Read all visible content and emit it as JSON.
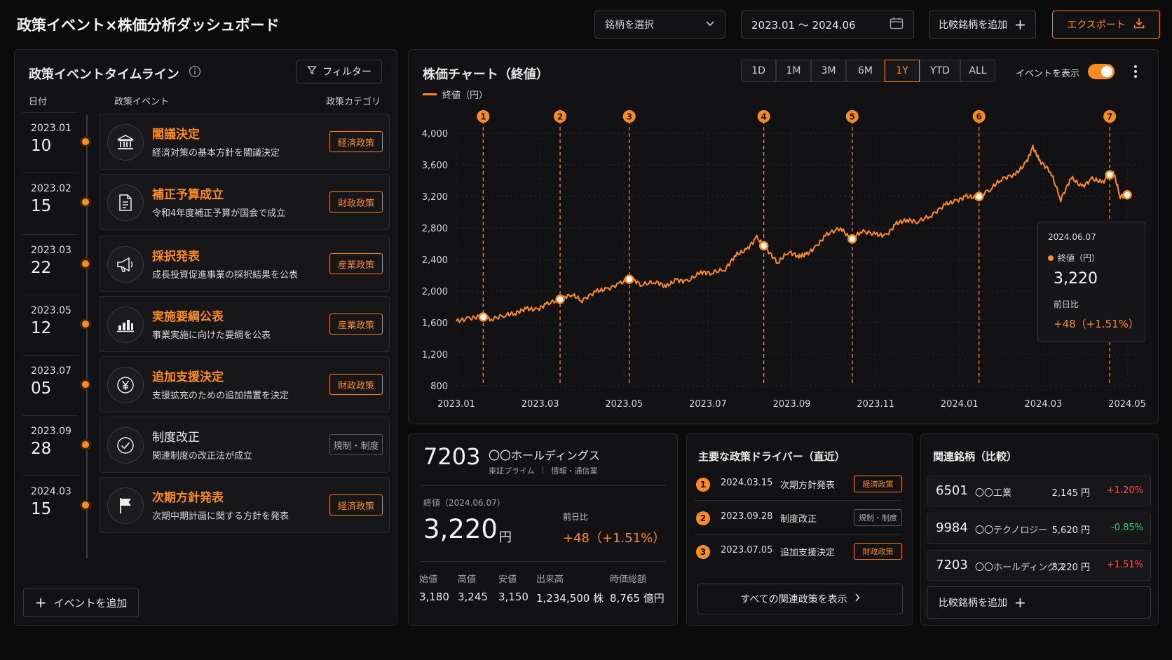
{
  "header": {
    "title": "政策イベント×株価分析ダッシュボード",
    "stock_select": "銘柄を選択",
    "date_range": "2023.01 〜 2024.06",
    "add_compare": "比較銘柄を追加",
    "export": "エクスポート"
  },
  "timeline": {
    "title": "政策イベントタイムライン",
    "filter": "フィルター",
    "col_date": "日付",
    "col_event": "政策イベント",
    "col_category": "政策カテゴリ",
    "add_event": "イベントを追加",
    "items": [
      {
        "ym": "2023.01",
        "d": "10",
        "title": "閣議決定",
        "desc": "経済対策の基本方針を閣議決定",
        "category": "経済政策",
        "icon": "building-icon",
        "highlight": true
      },
      {
        "ym": "2023.02",
        "d": "15",
        "title": "補正予算成立",
        "desc": "令和4年度補正予算が国会で成立",
        "category": "財政政策",
        "icon": "document-icon",
        "highlight": true
      },
      {
        "ym": "2023.03",
        "d": "22",
        "title": "採択発表",
        "desc": "成長投資促進事業の採択結果を公表",
        "category": "産業政策",
        "icon": "megaphone-icon",
        "highlight": true
      },
      {
        "ym": "2023.05",
        "d": "12",
        "title": "実施要綱公表",
        "desc": "事業実施に向けた要綱を公表",
        "category": "産業政策",
        "icon": "bar-chart-icon",
        "highlight": true
      },
      {
        "ym": "2023.07",
        "d": "05",
        "title": "追加支援決定",
        "desc": "支援拡充のための追加措置を決定",
        "category": "財政政策",
        "icon": "yen-icon",
        "highlight": true
      },
      {
        "ym": "2023.09",
        "d": "28",
        "title": "制度改正",
        "desc": "関連制度の改正法が成立",
        "category": "規制・制度",
        "icon": "check-circle-icon",
        "highlight": false
      },
      {
        "ym": "2024.03",
        "d": "15",
        "title": "次期方針発表",
        "desc": "次期中期計画に関する方針を発表",
        "category": "経済政策",
        "icon": "flag-icon",
        "highlight": true
      }
    ]
  },
  "chart": {
    "title": "株価チャート（終値）",
    "legend": "終値（円）",
    "ranges": [
      "1D",
      "1M",
      "3M",
      "6M",
      "1Y",
      "YTD",
      "ALL"
    ],
    "active_range": "1Y",
    "show_events_label": "イベントを表示",
    "tooltip": {
      "date": "2024.06.07",
      "label": "終値（円）",
      "value": "3,220",
      "change_label": "前日比",
      "change": "+48（+1.51%）"
    }
  },
  "chart_data": {
    "type": "line",
    "title": "株価チャート（終値）",
    "series": [
      {
        "name": "終値（円）",
        "color": "#ff8a1f"
      }
    ],
    "ylim": [
      800,
      4000
    ],
    "yticks": [
      800,
      1200,
      1600,
      2000,
      2400,
      2800,
      3200,
      3600,
      4000
    ],
    "xlim": [
      0,
      17.2
    ],
    "xticks": [
      {
        "t": 0,
        "label": "2023.01"
      },
      {
        "t": 2,
        "label": "2023.03"
      },
      {
        "t": 4,
        "label": "2023.05"
      },
      {
        "t": 6,
        "label": "2023.07"
      },
      {
        "t": 8,
        "label": "2023.09"
      },
      {
        "t": 10,
        "label": "2023.11"
      },
      {
        "t": 12,
        "label": "2024.01"
      },
      {
        "t": 14,
        "label": "2024.03"
      },
      {
        "t": 16,
        "label": "2024.05"
      }
    ],
    "points": [
      [
        0,
        1620
      ],
      [
        0.35,
        1650
      ],
      [
        0.7,
        1680
      ],
      [
        1.0,
        1640
      ],
      [
        1.4,
        1700
      ],
      [
        1.7,
        1720
      ],
      [
        2.0,
        1780
      ],
      [
        2.3,
        1760
      ],
      [
        2.6,
        1840
      ],
      [
        3.0,
        1900
      ],
      [
        3.3,
        1960
      ],
      [
        3.6,
        1880
      ],
      [
        4.0,
        2000
      ],
      [
        4.3,
        2020
      ],
      [
        4.7,
        2100
      ],
      [
        5.0,
        2160
      ],
      [
        5.3,
        2080
      ],
      [
        5.7,
        2120
      ],
      [
        6.0,
        2060
      ],
      [
        6.3,
        2140
      ],
      [
        6.6,
        2120
      ],
      [
        7.0,
        2240
      ],
      [
        7.3,
        2230
      ],
      [
        7.7,
        2280
      ],
      [
        8.0,
        2460
      ],
      [
        8.3,
        2520
      ],
      [
        8.6,
        2680
      ],
      [
        8.9,
        2520
      ],
      [
        9.2,
        2360
      ],
      [
        9.5,
        2500
      ],
      [
        9.8,
        2440
      ],
      [
        10.0,
        2460
      ],
      [
        10.3,
        2560
      ],
      [
        10.6,
        2720
      ],
      [
        11.0,
        2800
      ],
      [
        11.3,
        2650
      ],
      [
        11.6,
        2760
      ],
      [
        12.0,
        2720
      ],
      [
        12.3,
        2700
      ],
      [
        12.6,
        2860
      ],
      [
        12.9,
        2900
      ],
      [
        13.2,
        2880
      ],
      [
        13.6,
        2960
      ],
      [
        14.0,
        3100
      ],
      [
        14.3,
        3140
      ],
      [
        14.6,
        3200
      ],
      [
        14.9,
        3180
      ],
      [
        15.3,
        3300
      ],
      [
        15.6,
        3420
      ],
      [
        16.0,
        3480
      ],
      [
        16.3,
        3620
      ],
      [
        16.5,
        3820
      ],
      [
        16.7,
        3650
      ],
      [
        17.0,
        3520
      ],
      [
        17.3,
        3160
      ],
      [
        17.6,
        3440
      ],
      [
        17.9,
        3320
      ],
      [
        18.2,
        3420
      ],
      [
        18.5,
        3380
      ],
      [
        18.8,
        3520
      ],
      [
        19.0,
        3200
      ],
      [
        19.2,
        3220
      ]
    ],
    "events": [
      {
        "n": "1",
        "t": 0.35,
        "v": 1620
      },
      {
        "n": "2",
        "t": 1.35,
        "v": 1780
      },
      {
        "n": "3",
        "t": 2.25,
        "v": 2000
      },
      {
        "n": "4",
        "t": 4.0,
        "v": 2460
      },
      {
        "n": "5",
        "t": 5.15,
        "v": 2460
      },
      {
        "n": "6",
        "t": 6.8,
        "v": 3100
      },
      {
        "n": "7",
        "t": 8.5,
        "v": 3160
      }
    ]
  },
  "quote": {
    "code": "7203",
    "name": "〇〇ホールディングス",
    "market": "東証プライム",
    "sector": "情報・通信業",
    "close_label": "終値（2024.06.07）",
    "close": "3,220",
    "unit": "円",
    "change_label": "前日比",
    "change": "+48（+1.51%）",
    "stats": [
      {
        "label": "始値",
        "value": "3,180"
      },
      {
        "label": "高値",
        "value": "3,245"
      },
      {
        "label": "安値",
        "value": "3,150"
      },
      {
        "label": "出来高",
        "value": "1,234,500 株"
      },
      {
        "label": "時価総額",
        "value": "8,765 億円"
      }
    ]
  },
  "drivers": {
    "title": "主要な政策ドライバー（直近）",
    "items": [
      {
        "n": "1",
        "date": "2024.03.15",
        "name": "次期方針発表",
        "category": "経済政策",
        "gray": false
      },
      {
        "n": "2",
        "date": "2023.09.28",
        "name": "制度改正",
        "category": "規制・制度",
        "gray": true
      },
      {
        "n": "3",
        "date": "2023.07.05",
        "name": "追加支援決定",
        "category": "財政政策",
        "gray": false
      }
    ],
    "show_all": "すべての関連政策を表示"
  },
  "related": {
    "title": "関連銘柄（比較）",
    "items": [
      {
        "code": "6501",
        "name": "〇〇工業",
        "price": "2,145 円",
        "change": "+1.20%",
        "up": true
      },
      {
        "code": "9984",
        "name": "〇〇テクノロジー",
        "price": "5,620 円",
        "change": "-0.85%",
        "up": false
      },
      {
        "code": "7203",
        "name": "〇〇ホールディングス",
        "price": "3,220 円",
        "change": "+1.51%",
        "up": true
      }
    ],
    "add": "比較銘柄を追加"
  }
}
